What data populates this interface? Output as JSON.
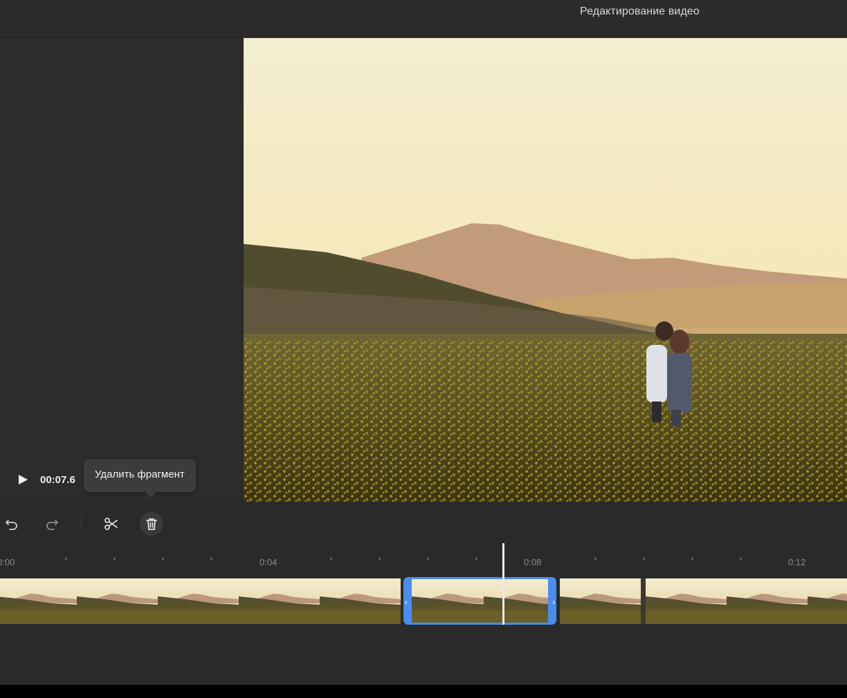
{
  "header": {
    "title": "Редактирование видео"
  },
  "player": {
    "timecode": "00:07.6",
    "play_icon": "play-icon"
  },
  "tooltip": {
    "text": "Удалить фрагмент"
  },
  "toolbar": {
    "undo_icon": "undo-icon",
    "redo_icon": "redo-icon",
    "split_icon": "scissors-icon",
    "delete_icon": "trash-icon"
  },
  "timeline": {
    "labels": [
      "0:00",
      "0:04",
      "0:08",
      "0:12"
    ],
    "playhead_time": "0:07.6",
    "selection_color": "#4a8df0"
  }
}
